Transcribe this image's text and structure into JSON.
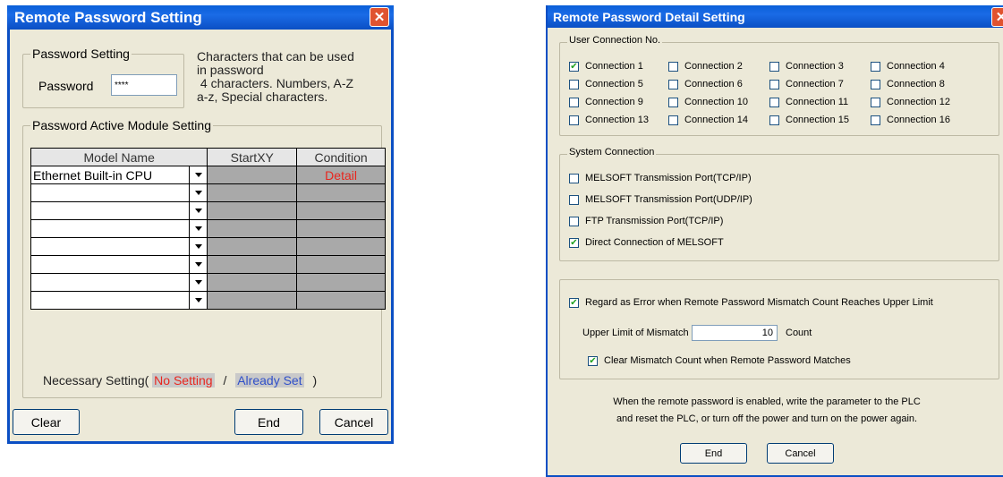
{
  "left_dialog": {
    "title": "Remote Password Setting",
    "password_group": {
      "legend": "Password Setting",
      "password_label": "Password",
      "password_value": "****",
      "hint_lines": [
        "Characters that can be used",
        "in password",
        " 4 characters. Numbers, A-Z",
        "a-z, Special characters."
      ]
    },
    "module_group": {
      "legend": "Password Active Module Setting",
      "columns": [
        "Model Name",
        "StartXY",
        "Condition"
      ],
      "rows": [
        {
          "model": "Ethernet Built-in CPU",
          "startxy": "",
          "condition": "Detail"
        },
        {
          "model": "",
          "startxy": "",
          "condition": ""
        },
        {
          "model": "",
          "startxy": "",
          "condition": ""
        },
        {
          "model": "",
          "startxy": "",
          "condition": ""
        },
        {
          "model": "",
          "startxy": "",
          "condition": ""
        },
        {
          "model": "",
          "startxy": "",
          "condition": ""
        },
        {
          "model": "",
          "startxy": "",
          "condition": ""
        },
        {
          "model": "",
          "startxy": "",
          "condition": ""
        }
      ],
      "legend_prefix": "Necessary Setting(",
      "no_setting": "No Setting",
      "separator": "/",
      "already_set": "Already Set",
      "legend_suffix": ")"
    },
    "buttons": {
      "clear": "Clear",
      "end": "End",
      "cancel": "Cancel"
    },
    "close_glyph": "✕"
  },
  "right_dialog": {
    "title": "Remote Password Detail Setting",
    "close_glyph": "✕",
    "user_connection": {
      "legend": "User Connection No.",
      "items": [
        {
          "label": "Connection 1",
          "checked": true
        },
        {
          "label": "Connection 2",
          "checked": false
        },
        {
          "label": "Connection 3",
          "checked": false
        },
        {
          "label": "Connection 4",
          "checked": false
        },
        {
          "label": "Connection 5",
          "checked": false
        },
        {
          "label": "Connection 6",
          "checked": false
        },
        {
          "label": "Connection 7",
          "checked": false
        },
        {
          "label": "Connection 8",
          "checked": false
        },
        {
          "label": "Connection 9",
          "checked": false
        },
        {
          "label": "Connection 10",
          "checked": false
        },
        {
          "label": "Connection 11",
          "checked": false
        },
        {
          "label": "Connection 12",
          "checked": false
        },
        {
          "label": "Connection 13",
          "checked": false
        },
        {
          "label": "Connection 14",
          "checked": false
        },
        {
          "label": "Connection 15",
          "checked": false
        },
        {
          "label": "Connection 16",
          "checked": false
        }
      ]
    },
    "system_connection": {
      "legend": "System Connection",
      "items": [
        {
          "label": "MELSOFT Transmission Port(TCP/IP)",
          "checked": false
        },
        {
          "label": "MELSOFT Transmission Port(UDP/IP)",
          "checked": false
        },
        {
          "label": "FTP Transmission Port(TCP/IP)",
          "checked": false
        },
        {
          "label": "Direct Connection of MELSOFT",
          "checked": true
        }
      ]
    },
    "mismatch": {
      "regard_error_label": "Regard as Error when Remote Password Mismatch Count Reaches Upper Limit",
      "regard_error_checked": true,
      "upper_limit_label": "Upper Limit of Mismatch",
      "upper_limit_value": "10",
      "count_label": "Count",
      "clear_label": "Clear Mismatch Count when Remote Password Matches",
      "clear_checked": true
    },
    "note_lines": [
      "When the remote password is enabled, write the parameter to the PLC",
      "and reset the PLC, or turn off the power and turn on the power again."
    ],
    "buttons": {
      "end": "End",
      "cancel": "Cancel"
    }
  }
}
